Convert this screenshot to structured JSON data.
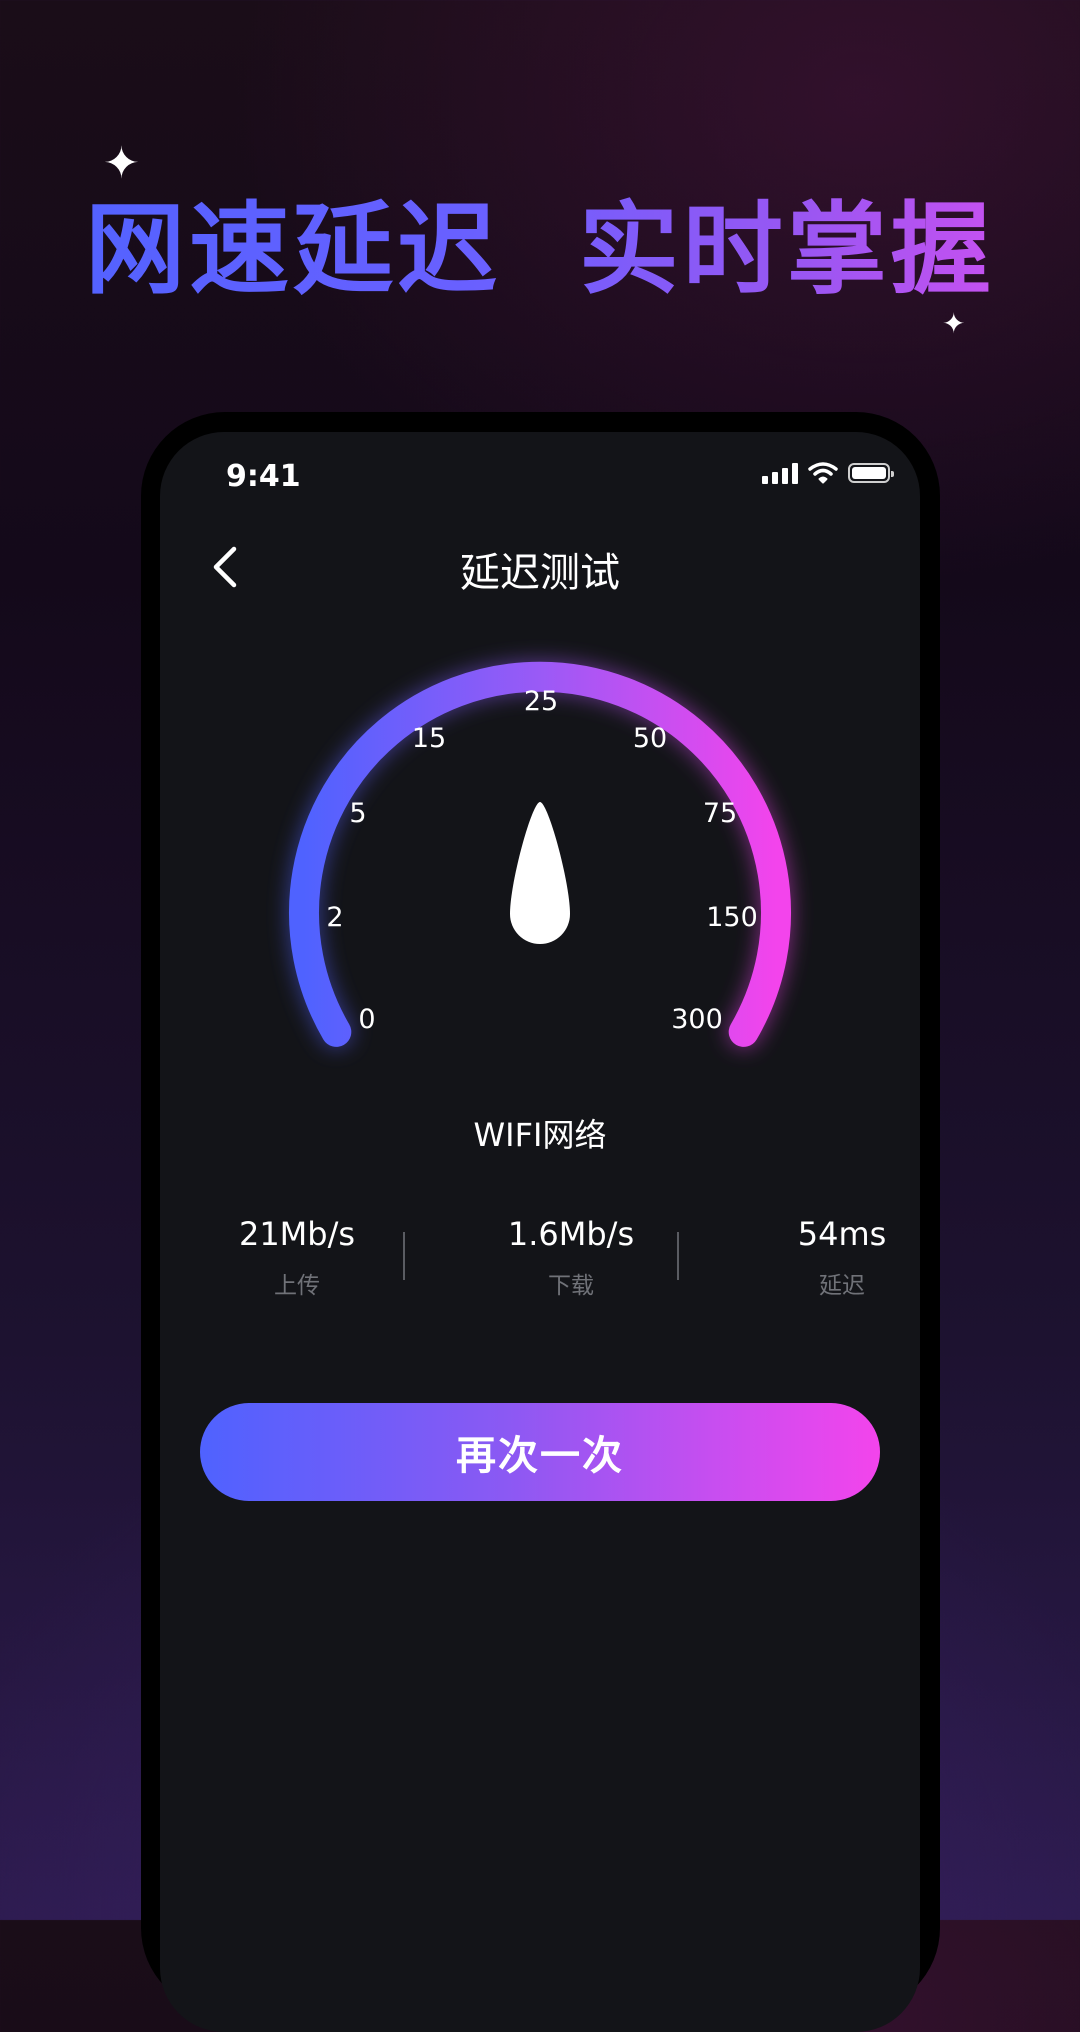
{
  "headline": "网速延迟  实时掌握",
  "status_bar": {
    "time": "9:41"
  },
  "nav": {
    "title": "延迟测试"
  },
  "gauge": {
    "tick_labels": [
      "0",
      "2",
      "5",
      "15",
      "25",
      "50",
      "75",
      "150",
      "300"
    ],
    "network": "WIFI网络",
    "gradient_start": "#4f62ff",
    "gradient_end": "#f344ec"
  },
  "stats": [
    {
      "value": "21Mb/s",
      "label": "上传"
    },
    {
      "value": "1.6Mb/s",
      "label": "下载"
    },
    {
      "value": "54ms",
      "label": "延迟"
    }
  ],
  "action": {
    "retry_label": "再次一次"
  },
  "icons": {
    "back": "chevron-left-icon",
    "signal": "signal-icon",
    "wifi": "wifi-icon",
    "battery": "battery-icon"
  },
  "colors": {
    "screen_background": "#131418",
    "accent_blue": "#4f62ff",
    "accent_pink": "#f344ec",
    "secondary_text": "#707278"
  }
}
